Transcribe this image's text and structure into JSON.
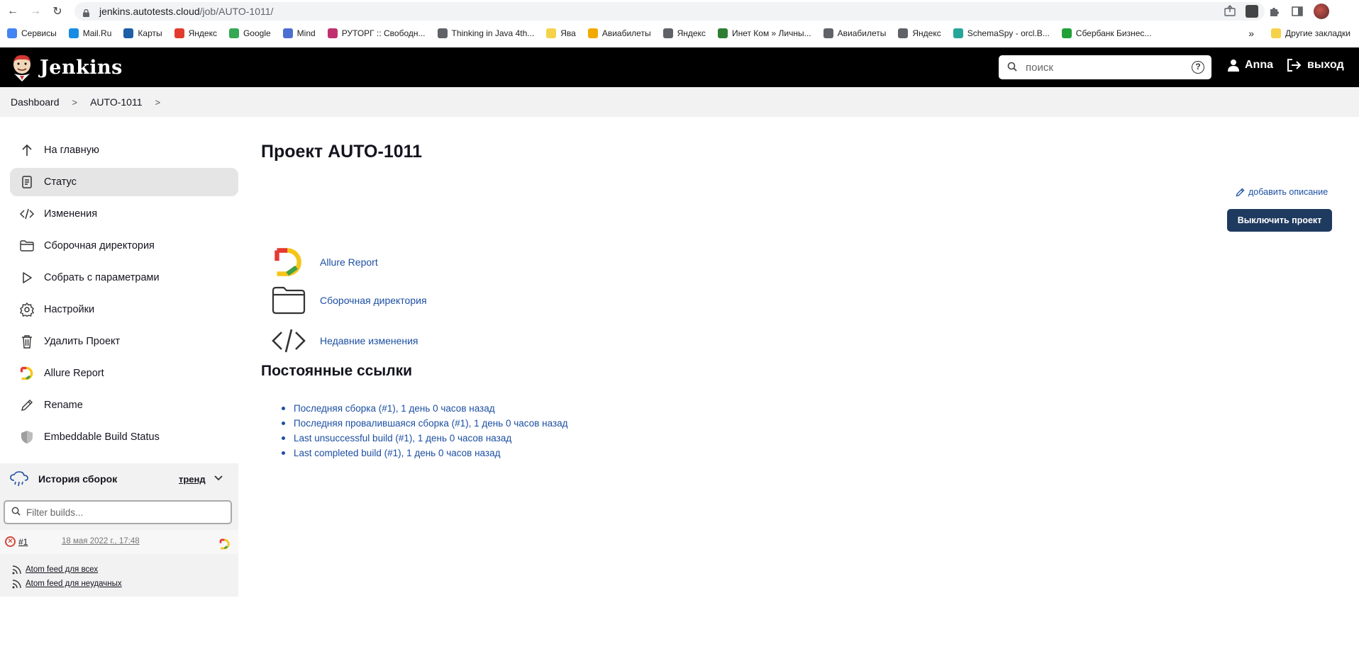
{
  "browser": {
    "url_host": "jenkins.autotests.cloud",
    "url_path": "/job/AUTO-1011/",
    "bookmarks": [
      {
        "label": "Сервисы",
        "color": "#4285f4"
      },
      {
        "label": "Mail.Ru",
        "color": "#168de2"
      },
      {
        "label": "Карты",
        "color": "#1e5fa8"
      },
      {
        "label": "Яндекс",
        "color": "#e23b2e"
      },
      {
        "label": "Google",
        "color": "#34a853"
      },
      {
        "label": "Mind",
        "color": "#4b6fd1"
      },
      {
        "label": "РУТОРГ :: Свободн...",
        "color": "#c0306e"
      },
      {
        "label": "Thinking in Java 4th...",
        "color": "#5f6368"
      },
      {
        "label": "Ява",
        "color": "#f5d24a"
      },
      {
        "label": "Авиабилеты",
        "color": "#f2a900"
      },
      {
        "label": "Яндекс",
        "color": "#5f6368"
      },
      {
        "label": "Инет Ком » Личны...",
        "color": "#2e7d32"
      },
      {
        "label": "Авиабилеты",
        "color": "#5f6368"
      },
      {
        "label": "Яндекс",
        "color": "#5f6368"
      },
      {
        "label": "SchemaSpy - orcl.B...",
        "color": "#26a69a"
      },
      {
        "label": "Сбербанк Бизнес...",
        "color": "#21a038"
      }
    ],
    "more_bookmarks": "»",
    "other_bookmarks": "Другие закладки"
  },
  "header": {
    "brand": "Jenkins",
    "search_placeholder": "поиск",
    "help": "?",
    "user": "Anna",
    "logout": "выход"
  },
  "breadcrumb": {
    "items": [
      "Dashboard",
      "AUTO-1011"
    ],
    "sep": ">"
  },
  "sidebar": {
    "items": [
      {
        "label": "На главную",
        "icon": "arrow-up-icon"
      },
      {
        "label": "Статус",
        "icon": "document-icon"
      },
      {
        "label": "Изменения",
        "icon": "code-icon"
      },
      {
        "label": "Сборочная директория",
        "icon": "folder-icon"
      },
      {
        "label": "Собрать с параметрами",
        "icon": "play-icon"
      },
      {
        "label": "Настройки",
        "icon": "gear-icon"
      },
      {
        "label": "Удалить Проект",
        "icon": "trash-icon"
      },
      {
        "label": "Allure Report",
        "icon": "allure-icon"
      },
      {
        "label": "Rename",
        "icon": "pencil-icon"
      },
      {
        "label": "Embeddable Build Status",
        "icon": "shield-icon"
      }
    ]
  },
  "history": {
    "title": "История сборок",
    "trend": "тренд",
    "filter_placeholder": "Filter builds...",
    "builds": [
      {
        "number": "#1",
        "date": "18 мая 2022 г., 17:48",
        "status": "failed"
      }
    ],
    "feeds": [
      "Atom feed для всех",
      "Atom feed для неудачных"
    ]
  },
  "main": {
    "title": "Проект AUTO-1011",
    "add_description": "добавить описание",
    "disable_button": "Выключить проект",
    "links": [
      {
        "label": "Allure Report",
        "icon": "allure-icon"
      },
      {
        "label": "Сборочная директория",
        "icon": "folder-icon"
      },
      {
        "label": "Недавние изменения",
        "icon": "code-icon"
      }
    ],
    "permalinks_title": "Постоянные ссылки",
    "permalinks": [
      "Последняя сборка (#1), 1 день 0 часов назад",
      "Последняя провалившаяся сборка (#1), 1 день 0 часов назад",
      "Last unsuccessful build (#1), 1 день 0 часов назад",
      "Last completed build (#1), 1 день 0 часов назад"
    ]
  },
  "colors": {
    "header_bg": "#000000",
    "link": "#1c4fa2",
    "button_bg": "#1f3a5f",
    "failed": "#d24939"
  }
}
